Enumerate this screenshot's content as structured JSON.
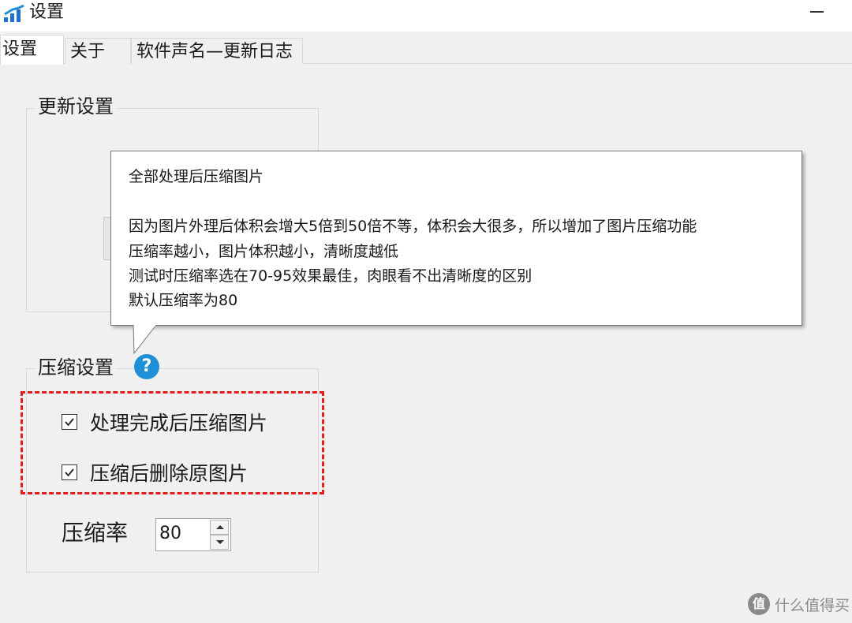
{
  "window": {
    "title": "设置",
    "minimize_icon": "minimize-icon",
    "app_icon": "signal-bars-icon"
  },
  "tabs": [
    {
      "label": "设置",
      "active": true
    },
    {
      "label": "关于",
      "active": false
    },
    {
      "label": "软件声名—更新日志",
      "active": false
    }
  ],
  "update_group": {
    "title": "更新设置"
  },
  "compress_group": {
    "title": "压缩设置",
    "help_icon": "question-mark-icon",
    "help_symbol": "?",
    "checkboxes": [
      {
        "label": "处理完成后压缩图片",
        "checked": true
      },
      {
        "label": "压缩后删除原图片",
        "checked": true
      }
    ],
    "ratio_label": "压缩率",
    "ratio_value": "80"
  },
  "tooltip": {
    "lines": [
      "全部处理后压缩图片",
      "",
      "因为图片外理后体积会增大5倍到50倍不等，体积会大很多，所以增加了图片压缩功能",
      "压缩率越小，图片体积越小，清晰度越低",
      "测试时压缩率选在70-95效果最佳，肉眼看不出清晰度的区别",
      "默认压缩率为80"
    ]
  },
  "watermark": {
    "logo": "值",
    "text": "什么值得买"
  },
  "colors": {
    "highlight_dash": "#e31e1e",
    "help_icon_bg": "#1f8fd8",
    "window_bg": "#f0f0f0"
  }
}
